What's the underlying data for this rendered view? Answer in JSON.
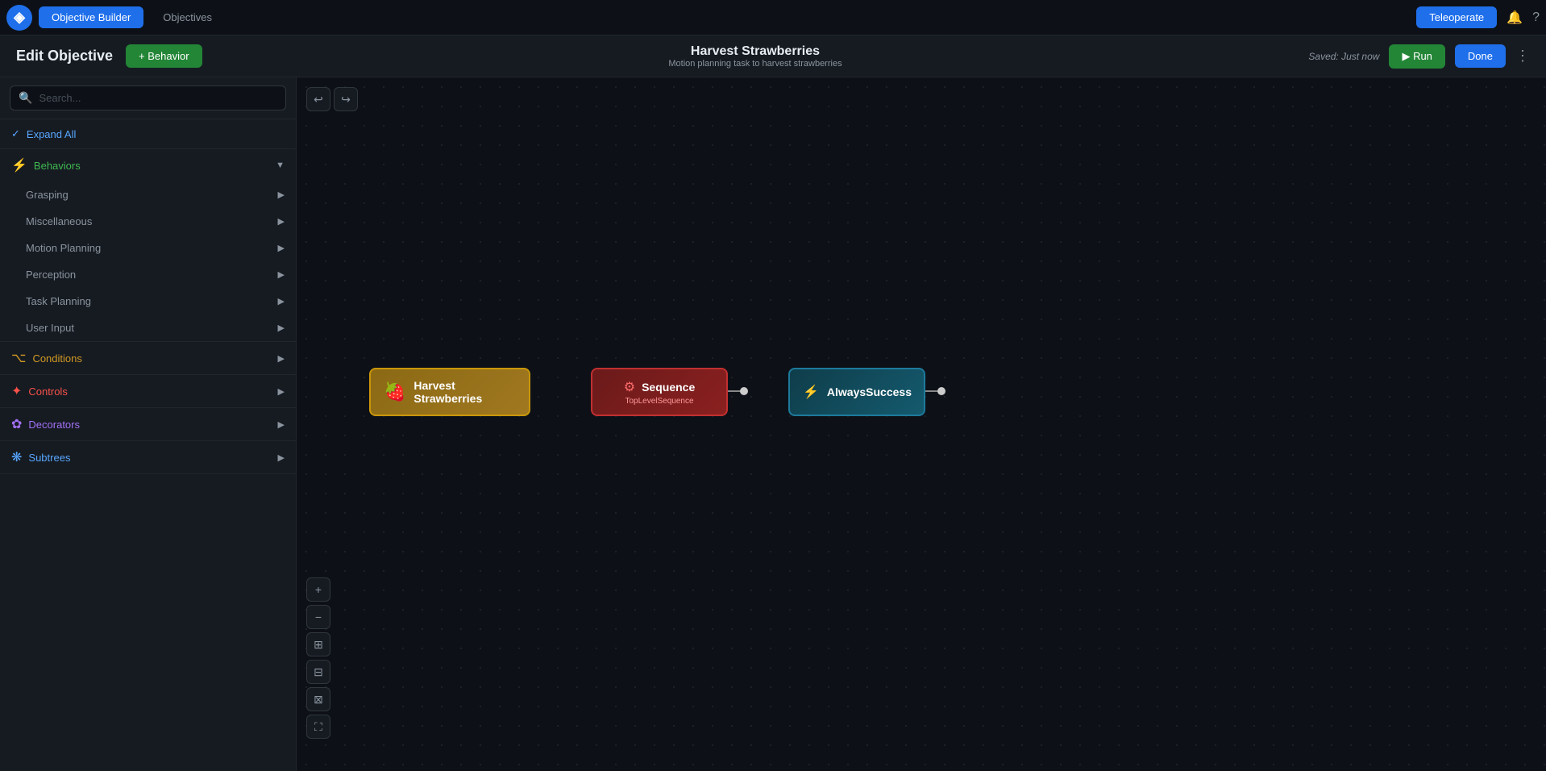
{
  "app": {
    "logo": "◈",
    "tabs": [
      {
        "label": "Objective Builder",
        "active": true
      },
      {
        "label": "Objectives",
        "active": false
      }
    ],
    "teleoperate_btn": "Teleoperate",
    "notification_icon": "🔔",
    "help_icon": "?"
  },
  "edit_header": {
    "title": "Edit Objective",
    "add_behavior_label": "+ Behavior",
    "objective_name": "Harvest Strawberries",
    "objective_subtitle": "Motion planning task to harvest strawberries",
    "saved_label": "Saved: Just now",
    "run_label": "▶ Run",
    "done_label": "Done",
    "more_icon": "⋮"
  },
  "sidebar": {
    "search_placeholder": "Search...",
    "expand_all_label": "Expand All",
    "categories": [
      {
        "id": "behaviors",
        "label": "Behaviors",
        "color_class": "behaviors-label",
        "icon": "⚡",
        "subcategories": [
          {
            "label": "Grasping"
          },
          {
            "label": "Miscellaneous"
          },
          {
            "label": "Motion Planning"
          },
          {
            "label": "Perception"
          },
          {
            "label": "Task Planning"
          },
          {
            "label": "User Input"
          }
        ]
      },
      {
        "id": "conditions",
        "label": "Conditions",
        "color_class": "conditions-label",
        "icon": "⌥",
        "subcategories": []
      },
      {
        "id": "controls",
        "label": "Controls",
        "color_class": "controls-label",
        "icon": "✦",
        "subcategories": []
      },
      {
        "id": "decorators",
        "label": "Decorators",
        "color_class": "decorators-label",
        "icon": "✿",
        "subcategories": []
      },
      {
        "id": "subtrees",
        "label": "Subtrees",
        "color_class": "subtrees-label",
        "icon": "❋",
        "subcategories": []
      }
    ]
  },
  "canvas": {
    "undo_icon": "↩",
    "redo_icon": "↪",
    "zoom_in_icon": "+",
    "zoom_out_icon": "−",
    "fit_icon": "⊞",
    "collapse_icon": "⊟",
    "grid_icon": "⊠",
    "fullscreen_icon": "⛶"
  },
  "nodes": {
    "harvest": {
      "label": "Harvest Strawberries",
      "icon": "🍓"
    },
    "sequence": {
      "label": "Sequence",
      "sublabel": "TopLevelSequence",
      "icon": "⚙"
    },
    "always_success": {
      "label": "AlwaysSuccess",
      "icon": "⚡"
    }
  }
}
